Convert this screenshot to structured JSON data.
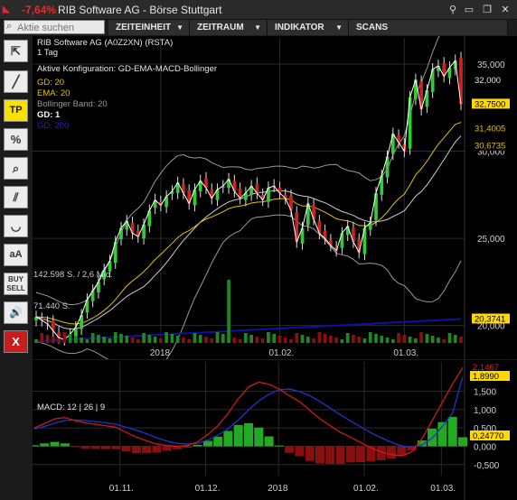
{
  "titlebar": {
    "change_pct": "-7,64%",
    "title": "RIB Software AG - Börse Stuttgart",
    "buttons": [
      "⚲",
      "▭",
      "❐",
      "✕"
    ]
  },
  "search": {
    "placeholder": "Aktie suchen"
  },
  "menu": [
    {
      "label": "ZEITEINHEIT"
    },
    {
      "label": "ZEITRAUM"
    },
    {
      "label": "INDIKATOR"
    },
    {
      "label": "SCANS"
    }
  ],
  "toolbar": {
    "items": [
      {
        "name": "cursor-tool",
        "glyph": "⇱"
      },
      {
        "name": "line-tool",
        "glyph": "╱"
      },
      {
        "name": "tp-tool",
        "glyph": "TP"
      },
      {
        "name": "percent-tool",
        "glyph": "%"
      },
      {
        "name": "zoom-tool",
        "glyph": "⌕"
      },
      {
        "name": "parallel-lines-tool",
        "glyph": "⫽"
      },
      {
        "name": "arc-tool",
        "glyph": "◡"
      },
      {
        "name": "text-size-tool",
        "glyph": "aA"
      },
      {
        "name": "buy-sell-button",
        "glyph": "BUY SELL"
      },
      {
        "name": "sound-tool",
        "glyph": "🔊"
      },
      {
        "name": "close-chart-button",
        "glyph": "X"
      }
    ]
  },
  "legend": {
    "line1": "RIB Software AG (A0Z2XN) (RSTA)",
    "line2": "1 Tag",
    "line3": "Aktive Konfiguration: GD-EMA-MACD-Bollinger",
    "gd20": "GD: 20",
    "ema20": "EMA: 20",
    "boll": "Bollinger Band: 20",
    "gd1": "GD: 1",
    "gd200": "GD: 200",
    "vol_max": "142.598 S. / 2,6 Mio.",
    "vol_avg": "71.440 S."
  },
  "colors": {
    "up": "#33cc33",
    "down": "#cc2222",
    "ema": "#e6c200",
    "gd20": "#cccccc",
    "gd200": "#1010a0",
    "macd": "#cc1a1a",
    "signal": "#2233cc",
    "hist_pos": "#22aa22",
    "hist_neg": "#8a1010"
  },
  "chart_data": [
    {
      "type": "candlestick",
      "title": "RIB Software AG (A0Z2XN) (RSTA)",
      "ylim": [
        19000,
        36500
      ],
      "y_ticks": [
        20000,
        25000,
        30000,
        35000
      ],
      "y_tick_labels": [
        "20,000",
        "25,000",
        "30,000",
        "35,000"
      ],
      "x_ticks": [
        "2018",
        "01.02.",
        "01.03."
      ],
      "close": [
        20500,
        20300,
        20100,
        19700,
        19300,
        19200,
        19500,
        19900,
        20600,
        21500,
        22000,
        22500,
        23200,
        23700,
        24800,
        25600,
        26000,
        25300,
        25100,
        25800,
        26600,
        27200,
        26900,
        27400,
        27700,
        28200,
        27600,
        27000,
        27800,
        28300,
        27900,
        27300,
        27800,
        28000,
        28400,
        27700,
        27300,
        27600,
        28000,
        27600,
        27200,
        27900,
        28000,
        27600,
        27300,
        26600,
        24800,
        25600,
        27000,
        26100,
        25300,
        25000,
        24600,
        24300,
        25300,
        25700,
        24800,
        24200,
        25600,
        25900,
        27600,
        28600,
        29700,
        31000,
        30500,
        30000,
        33100,
        34100,
        32400,
        33500,
        34700,
        34900,
        34300,
        34800,
        35200,
        32700
      ],
      "labels_right": {
        "close": "32,7500",
        "ema": "31,4005",
        "gd20": "30,6735",
        "gd200": "20,3741",
        "high": "32,000"
      },
      "volume_labels": [
        "142.598 S. / 2,6 Mio.",
        "71.440 S."
      ]
    },
    {
      "type": "line",
      "title": "MACD: 12 | 26 | 9",
      "ylim": [
        -800,
        2300
      ],
      "y_ticks": [
        -500,
        0,
        500,
        1000,
        1500
      ],
      "y_tick_labels": [
        "-0,500",
        "0,000",
        "0,500",
        "1,000",
        "1,500"
      ],
      "x_ticks": [
        "01.11.",
        "01.12.",
        "2018",
        "01.02.",
        "01.03."
      ],
      "series": [
        {
          "name": "MACD",
          "values": [
            500,
            620,
            750,
            780,
            700,
            640,
            600,
            560,
            520,
            380,
            250,
            150,
            60,
            20,
            0,
            20,
            120,
            320,
            560,
            900,
            1300,
            1620,
            1750,
            1690,
            1560,
            1380,
            1220,
            980,
            750,
            560,
            380,
            250,
            100,
            -40,
            -150,
            -230,
            -260,
            -150,
            200,
            700,
            1200,
            1700,
            2146
          ]
        },
        {
          "name": "Signal",
          "values": [
            470,
            540,
            630,
            700,
            720,
            700,
            670,
            640,
            600,
            520,
            440,
            340,
            230,
            140,
            80,
            60,
            80,
            170,
            300,
            480,
            720,
            990,
            1240,
            1420,
            1540,
            1560,
            1490,
            1380,
            1220,
            1040,
            860,
            690,
            530,
            370,
            230,
            110,
            10,
            -30,
            40,
            220,
            540,
            900,
            1899
          ]
        }
      ],
      "labels_right": {
        "macd": "2,1467",
        "signal": "1,8990",
        "hist": "0,24770"
      }
    }
  ]
}
